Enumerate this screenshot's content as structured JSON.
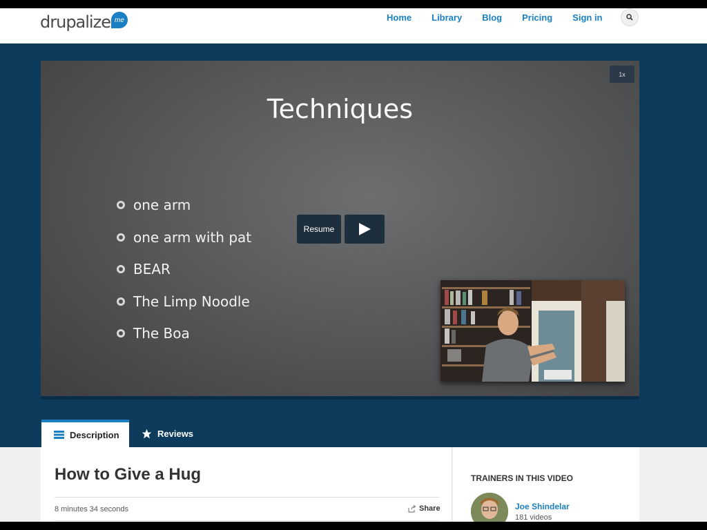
{
  "header": {
    "logo_text": "drupalize",
    "logo_badge": "me",
    "nav": [
      "Home",
      "Library",
      "Blog",
      "Pricing",
      "Sign in"
    ]
  },
  "player": {
    "speed": "1x",
    "slide_title": "Techniques",
    "bullets": [
      "one arm",
      "one arm with pat",
      "BEAR",
      "The Limp Noodle",
      "The Boa"
    ],
    "resume_label": "Resume"
  },
  "tabs": {
    "description": "Description",
    "reviews": "Reviews"
  },
  "video": {
    "title": "How to Give a Hug",
    "duration": "8 minutes 34 seconds",
    "share_label": "Share"
  },
  "trainers": {
    "heading": "TRAINERS IN THIS VIDEO",
    "name": "Joe Shindelar",
    "count": "181 videos"
  },
  "colors": {
    "accent": "#1a7fc3",
    "band": "#0d3b5b",
    "button_dark": "#1d2e3c"
  }
}
